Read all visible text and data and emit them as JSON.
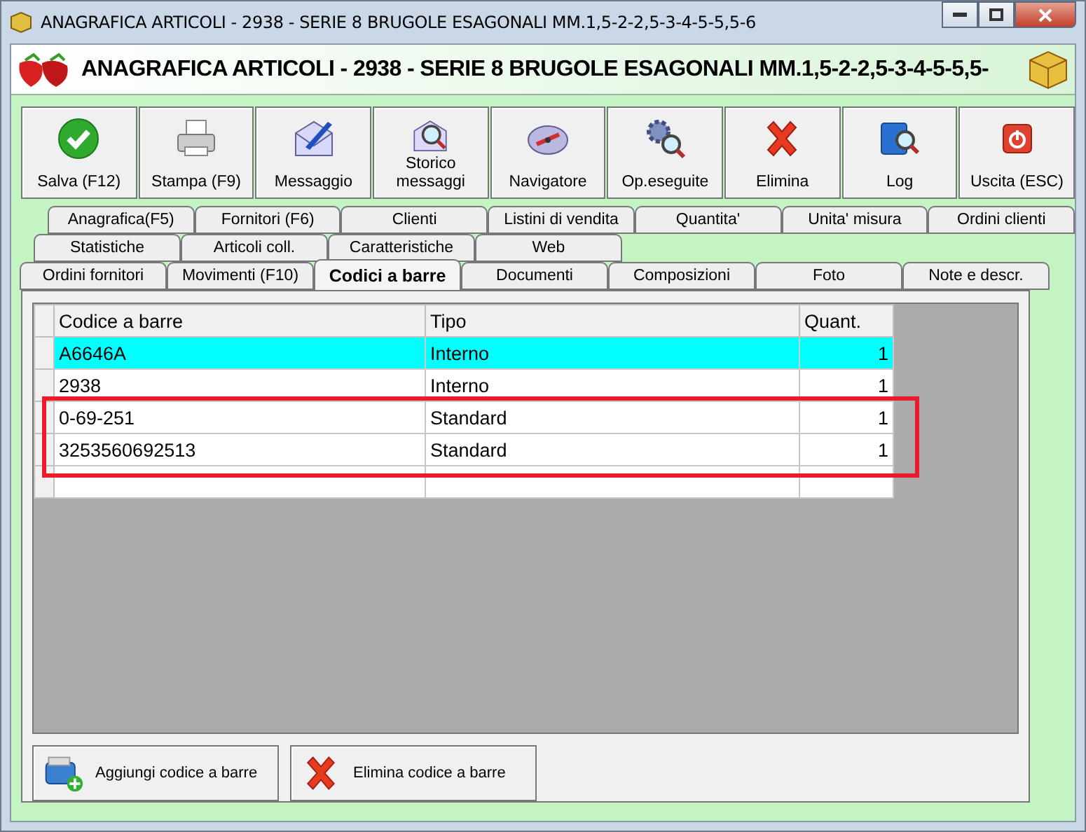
{
  "window": {
    "title": "ANAGRAFICA ARTICOLI - 2938 - SERIE 8 BRUGOLE ESAGONALI MM.1,5-2-2,5-3-4-5-5,5-6"
  },
  "header": {
    "title": "ANAGRAFICA ARTICOLI - 2938 - SERIE 8 BRUGOLE ESAGONALI MM.1,5-2-2,5-3-4-5-5,5-"
  },
  "toolbar": [
    {
      "label": "Salva (F12)",
      "kind": "check"
    },
    {
      "label": "Stampa (F9)",
      "kind": "printer"
    },
    {
      "label": "Messaggio",
      "kind": "mail"
    },
    {
      "label": "Storico messaggi",
      "kind": "mailsearch"
    },
    {
      "label": "Navigatore",
      "kind": "compass"
    },
    {
      "label": "Op.eseguite",
      "kind": "gears"
    },
    {
      "label": "Elimina",
      "kind": "cross"
    },
    {
      "label": "Log",
      "kind": "book"
    },
    {
      "label": "Uscita (ESC)",
      "kind": "power"
    }
  ],
  "tab_rows": [
    [
      {
        "label": "Anagrafica(F5)",
        "selected": false
      },
      {
        "label": "Fornitori (F6)",
        "selected": false
      },
      {
        "label": "Clienti",
        "selected": false
      },
      {
        "label": "Listini di vendita",
        "selected": false
      },
      {
        "label": "Quantita'",
        "selected": false
      },
      {
        "label": "Unita' misura",
        "selected": false
      },
      {
        "label": "Ordini clienti",
        "selected": false
      }
    ],
    [
      {
        "label": "Statistiche",
        "selected": false
      },
      {
        "label": "Articoli coll.",
        "selected": false
      },
      {
        "label": "Caratteristiche",
        "selected": false
      },
      {
        "label": "Web",
        "selected": false
      }
    ],
    [
      {
        "label": "Ordini fornitori",
        "selected": false
      },
      {
        "label": "Movimenti (F10)",
        "selected": false
      },
      {
        "label": "Codici a barre",
        "selected": true
      },
      {
        "label": "Documenti",
        "selected": false
      },
      {
        "label": "Composizioni",
        "selected": false
      },
      {
        "label": "Foto",
        "selected": false
      },
      {
        "label": "Note e descr.",
        "selected": false
      }
    ]
  ],
  "table": {
    "columns": [
      "Codice a barre",
      "Tipo",
      "Quant."
    ],
    "rows": [
      {
        "cells": [
          "A6646A",
          "Interno",
          "1"
        ],
        "selected": true
      },
      {
        "cells": [
          "2938",
          "Interno",
          "1"
        ],
        "selected": false
      }
    ],
    "highlighted_rows": [
      {
        "cells": [
          "0-69-251",
          "Standard",
          "1"
        ],
        "selected": false
      },
      {
        "cells": [
          "3253560692513",
          "Standard",
          "1"
        ],
        "selected": false
      }
    ]
  },
  "actions": [
    {
      "label": "Aggiungi codice a barre",
      "kind": "add"
    },
    {
      "label": "Elimina codice a barre",
      "kind": "cross"
    }
  ]
}
